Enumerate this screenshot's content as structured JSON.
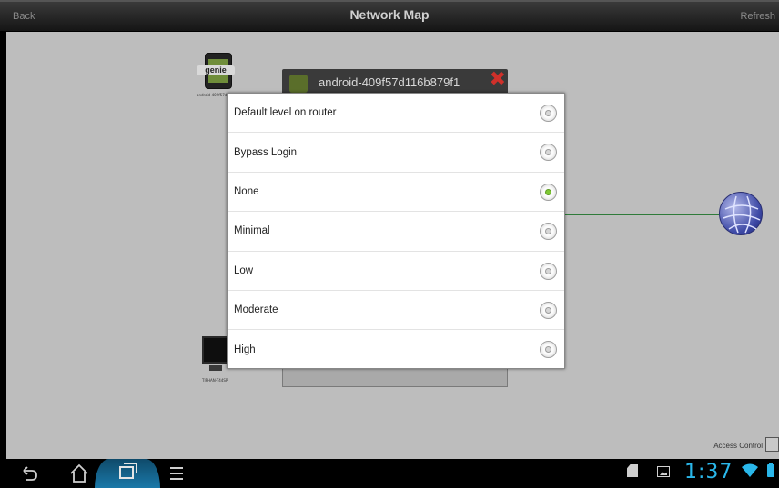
{
  "topbar": {
    "back_label": "Back",
    "title": "Network Map",
    "refresh_label": "Refresh"
  },
  "map": {
    "phone_node": {
      "badge": "genie",
      "label": "android-409f57d116b879f1"
    },
    "device_popup": {
      "title": "android-409f57d116b879f1"
    },
    "monitor_node": {
      "label": "TIPHAN-T44SP"
    },
    "access_control_label": "Access Control",
    "link_color": "#2f7b3a"
  },
  "dialog": {
    "options": [
      {
        "label": "Default level on router",
        "checked": false
      },
      {
        "label": "Bypass Login",
        "checked": false
      },
      {
        "label": "None",
        "checked": true
      },
      {
        "label": "Minimal",
        "checked": false
      },
      {
        "label": "Low",
        "checked": false
      },
      {
        "label": "Moderate",
        "checked": false
      },
      {
        "label": "High",
        "checked": false
      }
    ]
  },
  "statusbar": {
    "time": "1:37",
    "accent_color": "#2ab7ea"
  }
}
